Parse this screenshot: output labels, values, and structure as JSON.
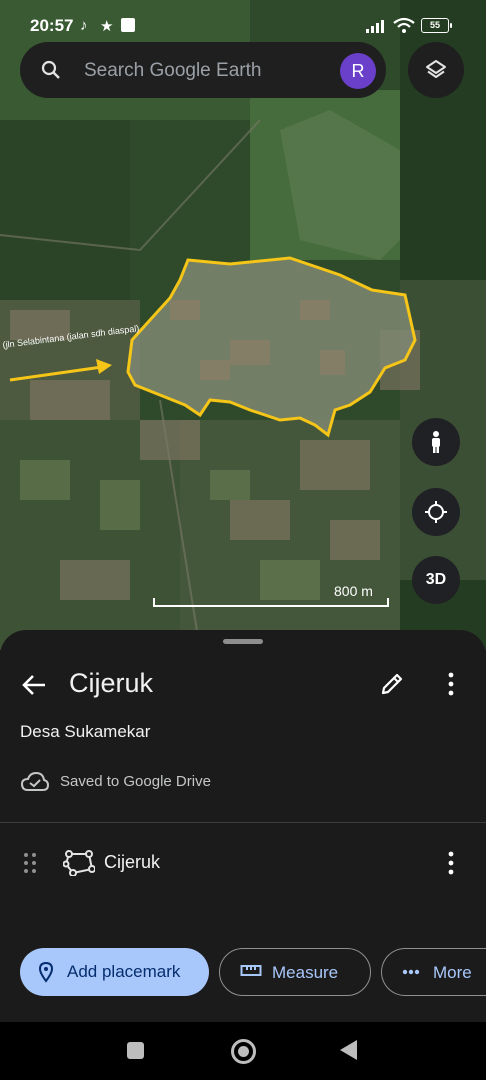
{
  "status_bar": {
    "time": "20:57",
    "battery": "55"
  },
  "search": {
    "placeholder": "Search Google Earth",
    "avatar_letter": "R"
  },
  "map": {
    "annotation": "(jln Selabintana (jalan sdh diaspal)",
    "scale_label": "800 m",
    "fab_3d_label": "3D",
    "polygon_color": "#f5c518"
  },
  "sheet": {
    "title": "Cijeruk",
    "subtitle": "Desa Sukamekar",
    "saved_text": "Saved to Google Drive",
    "feature_name": "Cijeruk"
  },
  "actions": {
    "add_placemark": "Add placemark",
    "measure": "Measure",
    "more": "More"
  },
  "icons": [
    "search-icon",
    "layers-icon",
    "pegman-icon",
    "my-location-icon",
    "back-arrow-icon",
    "pencil-icon",
    "more-vert-icon",
    "cloud-check-icon",
    "drag-handle-icon",
    "polygon-icon",
    "location-pin-icon",
    "ruler-icon",
    "more-horiz-icon"
  ],
  "colors": {
    "accent": "#a8c7fa",
    "avatar": "#6a3fc9",
    "sheet_bg": "#1b1b1b"
  }
}
